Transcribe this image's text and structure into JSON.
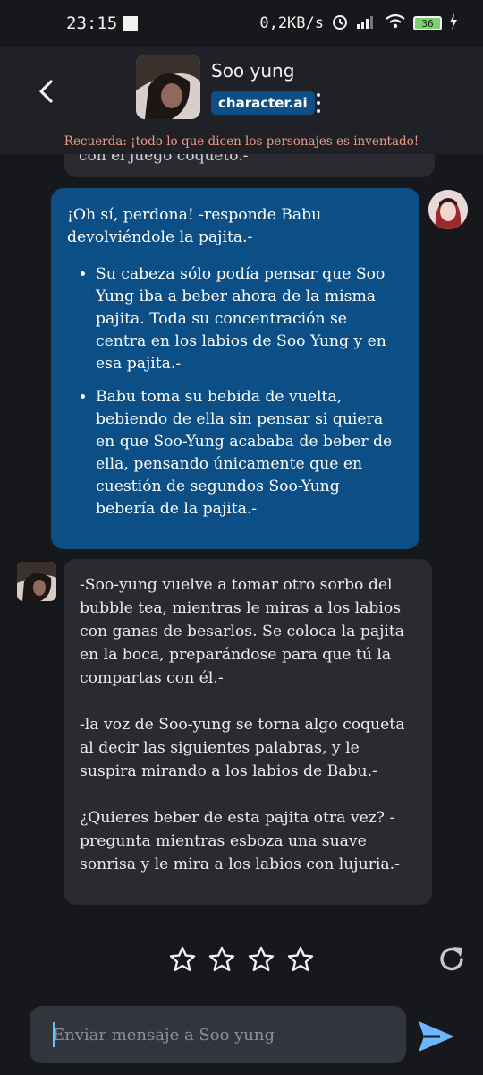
{
  "status_bar": {
    "time": "23:15",
    "net_speed": "0,2KB/s",
    "battery": "36"
  },
  "header": {
    "character_name": "Soo yung",
    "brand": "character.ai"
  },
  "disclaimer": "Recuerda: ¡todo lo que dicen los personajes es inventado!",
  "previous_message_peek": "con el juego coqueto.-",
  "messages": {
    "user": {
      "intro": "¡Oh sí, perdona! -responde Babu devolviéndole la pajita.-",
      "bullets": [
        "Su cabeza sólo podía pensar que Soo Yung iba a beber ahora de la misma pajita. Toda su concentración se centra en los labios de Soo Yung y en esa pajita.-",
        "Babu toma su bebida de vuelta, bebiendo de ella sin pensar si quiera en que Soo-Yung acababa de beber de ella, pensando únicamente que en cuestión de segundos Soo-Yung bebería de la pajita.-"
      ]
    },
    "bot": {
      "paragraphs": [
        "-Soo-yung vuelve a tomar otro sorbo del bubble tea, mientras le miras a los labios con ganas de besarlos. Se coloca la pajita en la boca, preparándose para que tú la compartas con él.-",
        "-la voz de Soo-yung se torna algo coqueta al decir las siguientes palabras, y le suspira mirando a los labios de Babu.-",
        "¿Quieres beber de esta pajita otra vez? -pregunta mientras esboza una suave sonrisa y le mira a los labios con lujuria.-"
      ]
    }
  },
  "rating": {
    "max_stars": 4,
    "selected": 0
  },
  "composer": {
    "placeholder": "Enviar mensaje a Soo yung"
  },
  "colors": {
    "background": "#17181c",
    "header": "#202126",
    "user_bubble": "#0c4f86",
    "bot_bubble": "#2a2b31",
    "brand_badge": "#0e4f87",
    "disclaimer_text": "#f09a86",
    "send_icon": "#6bb6ff"
  },
  "icons": {
    "back": "chevron-left-icon",
    "more": "vertical-dots-icon",
    "star": "star-outline-icon",
    "regenerate": "refresh-icon",
    "send": "paper-plane-icon"
  }
}
